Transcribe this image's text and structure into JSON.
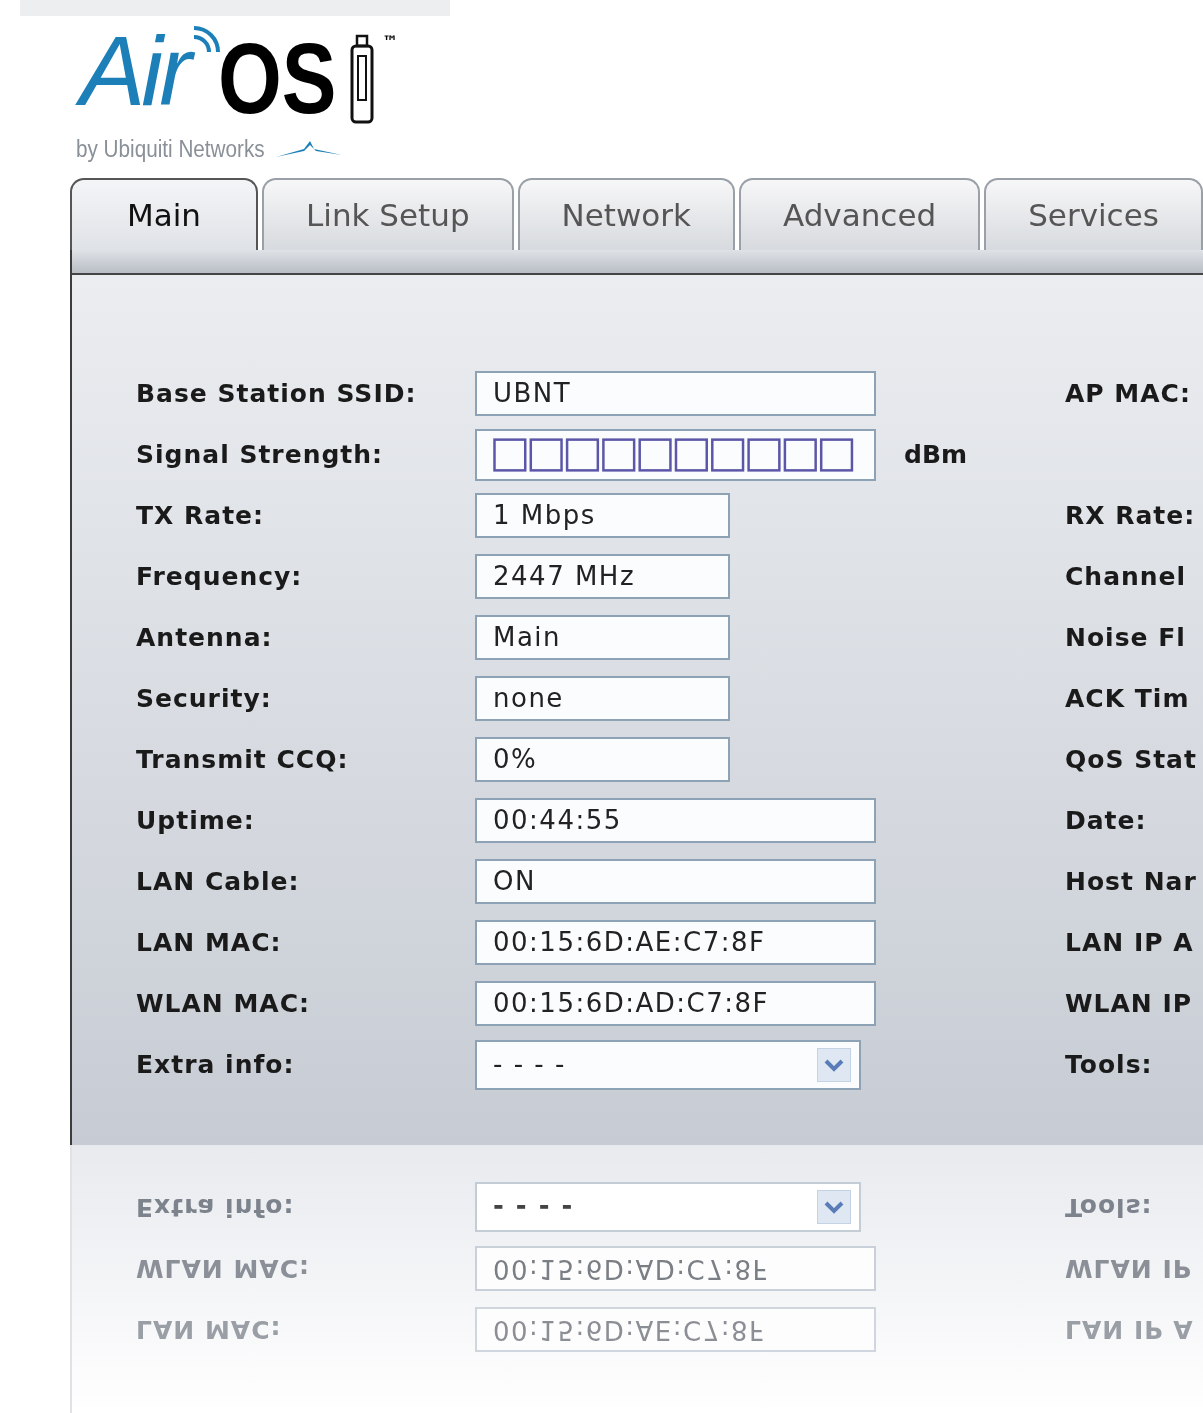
{
  "logo": {
    "air": "Air",
    "os": "OS",
    "tm": "™",
    "tagline": "by Ubiquiti Networks"
  },
  "tabs": [
    {
      "label": "Main",
      "selected": true
    },
    {
      "label": "Link Setup",
      "selected": false
    },
    {
      "label": "Network",
      "selected": false
    },
    {
      "label": "Advanced",
      "selected": false
    },
    {
      "label": "Services",
      "selected": false
    }
  ],
  "rows": [
    {
      "label": "Base Station SSID:",
      "kind": "field",
      "value": "UBNT",
      "right_label": "AP MAC:"
    },
    {
      "label": "Signal Strength:",
      "kind": "meter",
      "unit": "dBm"
    },
    {
      "label": "TX Rate:",
      "kind": "short-field",
      "value": "1 Mbps",
      "right_label": "RX Rate:"
    },
    {
      "label": "Frequency:",
      "kind": "short-field",
      "value": "2447 MHz",
      "right_label": "Channel"
    },
    {
      "label": "Antenna:",
      "kind": "short-field",
      "value": "Main",
      "right_label": "Noise Fl"
    },
    {
      "label": "Security:",
      "kind": "short-field",
      "value": "none",
      "right_label": "ACK Tim"
    },
    {
      "label": "Transmit CCQ:",
      "kind": "short-field",
      "value": " 0%",
      "right_label": "QoS Stat"
    },
    {
      "label": "Uptime:",
      "kind": "field",
      "value": "00:44:55",
      "right_label": "Date:"
    },
    {
      "label": "LAN Cable:",
      "kind": "field",
      "value": "ON",
      "right_label": "Host Nar"
    },
    {
      "label": "LAN MAC:",
      "kind": "field",
      "value": "00:15:6D:AE:C7:8F",
      "right_label": "LAN IP A"
    },
    {
      "label": "WLAN MAC:",
      "kind": "field",
      "value": "00:15:6D:AD:C7:8F",
      "right_label": "WLAN IP"
    },
    {
      "label": "Extra info:",
      "kind": "select",
      "value": "- - - -",
      "right_label": "Tools:"
    }
  ],
  "reflection": [
    {
      "label": "Extra info:",
      "kind": "select",
      "value": "- - - -",
      "right_label": "Tools:"
    },
    {
      "label": "WLAN MAC:",
      "kind": "field",
      "value": "00:15:6D:AD:C7:8F",
      "right_label": "WLAN IP"
    },
    {
      "label": "LAN MAC:",
      "kind": "field",
      "value": "00:15:6D:AE:C7:8F",
      "right_label": "LAN IP A"
    }
  ]
}
